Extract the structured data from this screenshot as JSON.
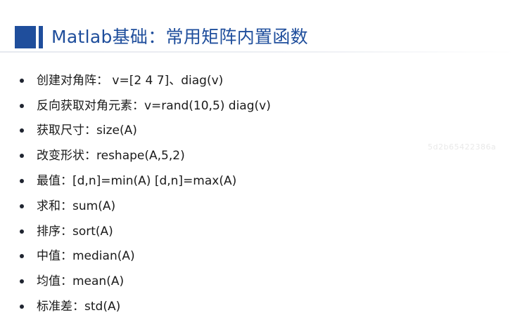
{
  "slide": {
    "title": "Matlab基础：常用矩阵内置函数",
    "watermark": "5d2b65422386a",
    "items": [
      "创建对角阵： v=[2 4 7]、diag(v)",
      "反向获取对角元素：v=rand(10,5) diag(v)",
      "获取尺寸：size(A)",
      "改变形状：reshape(A,5,2)",
      "最值：[d,n]=min(A) [d,n]=max(A)",
      "求和：sum(A)",
      "排序：sort(A)",
      "中值：median(A)",
      "均值：mean(A)",
      "标准差：std(A)"
    ]
  },
  "colors": {
    "accent": "#1f4e9c",
    "text": "#1a1a1a",
    "background": "#ffffff"
  }
}
